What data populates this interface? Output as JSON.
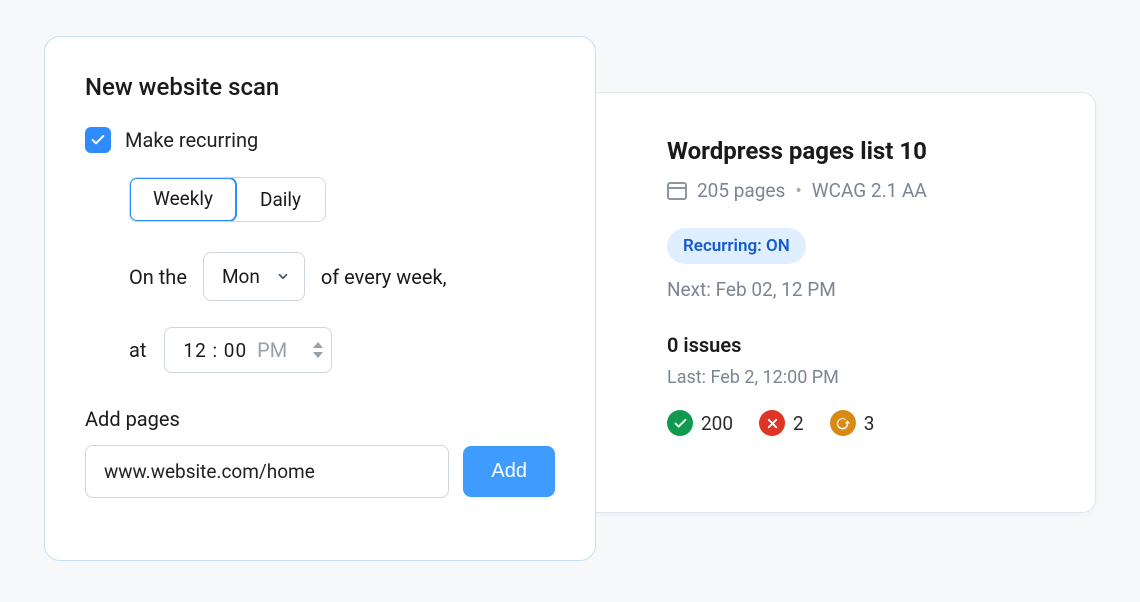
{
  "scan_form": {
    "title": "New website scan",
    "make_recurring_label": "Make recurring",
    "make_recurring_checked": true,
    "frequency_options": {
      "weekly": "Weekly",
      "daily": "Daily"
    },
    "selected_frequency": "weekly",
    "on_the_prefix": "On the",
    "of_every_week_suffix": "of every week,",
    "day_selected": "Mon",
    "at_label": "at",
    "time_value": "12 : 00",
    "ampm": "PM",
    "add_pages_label": "Add pages",
    "url_value": "www.website.com/home",
    "add_button_label": "Add"
  },
  "scan_info": {
    "title": "Wordpress pages list 10",
    "pages_count": "205 pages",
    "standard": "WCAG 2.1 AA",
    "recurring_badge": "Recurring: ON",
    "next_label": "Next: Feb 02, 12 PM",
    "issues_title": "0 issues",
    "last_label": "Last: Feb 2, 12:00 PM",
    "stats": {
      "passed": "200",
      "failed": "2",
      "pending": "3"
    }
  }
}
